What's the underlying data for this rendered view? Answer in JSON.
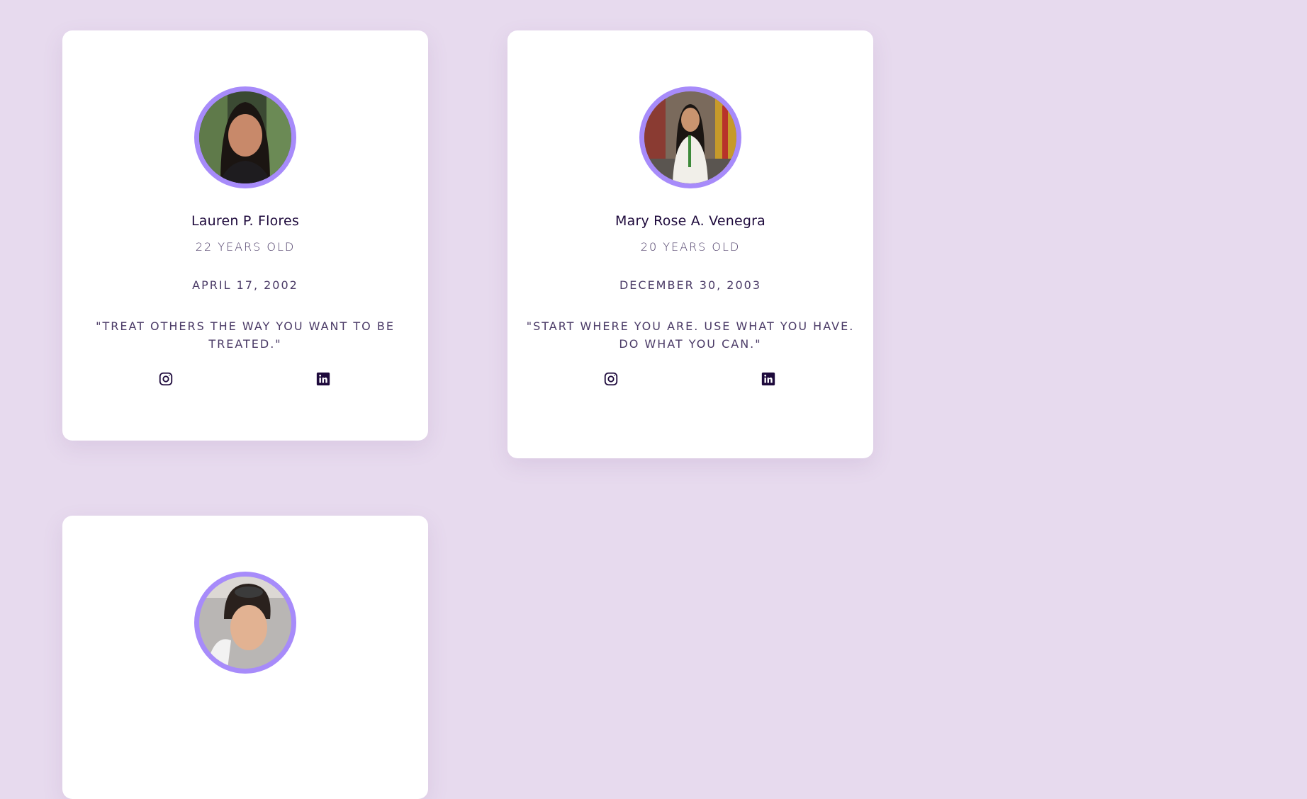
{
  "profiles": [
    {
      "name": "Lauren P. Flores",
      "age": "22 YEARS OLD",
      "birthday": "APRIL 17, 2002",
      "quote": "\"TREAT OTHERS THE WAY YOU WANT TO BE TREATED.\"",
      "socials": [
        {
          "icon": "instagram-icon"
        },
        {
          "icon": "linkedin-icon"
        }
      ]
    },
    {
      "name": "Mary Rose A. Venegra",
      "age": "20 YEARS OLD",
      "birthday": "DECEMBER 30, 2003",
      "quote": "\"START WHERE YOU ARE. USE WHAT YOU HAVE. DO WHAT YOU CAN.\"",
      "socials": [
        {
          "icon": "instagram-icon"
        },
        {
          "icon": "linkedin-icon"
        }
      ]
    },
    {
      "name": "",
      "age": "",
      "birthday": "",
      "quote": "",
      "socials": []
    }
  ],
  "colors": {
    "background": "#e7daee",
    "card": "#ffffff",
    "avatar_ring": "#a78bfa",
    "name_text": "#1e0a3c",
    "body_text": "#4a3a66",
    "icon": "#1e0a3c"
  }
}
